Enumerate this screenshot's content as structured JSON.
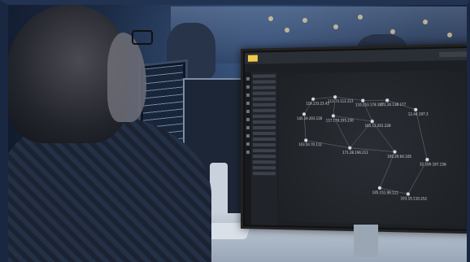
{
  "scene": {
    "description_tags": [
      "office",
      "monitors",
      "analyst"
    ]
  },
  "app": {
    "logo_label": "",
    "nav": [
      "",
      "",
      ""
    ],
    "tabs": [
      "",
      "",
      "",
      "",
      ""
    ],
    "nodes": [
      {
        "label": "119.233.23.43"
      },
      {
        "label": "113.73.112.213"
      },
      {
        "label": "110.253.178.165"
      },
      {
        "label": "172.24.138.177"
      },
      {
        "label": "145.19.203.128"
      },
      {
        "label": "117.178.195.230"
      },
      {
        "label": "165.12.201.228"
      },
      {
        "label": "12.44.197.3"
      },
      {
        "label": "103.50.70.112"
      },
      {
        "label": "171.28.190.211"
      },
      {
        "label": "100.29.64.105"
      },
      {
        "label": "32.109.167.156"
      },
      {
        "label": "105.151.99.111"
      },
      {
        "label": "103.19.110.252"
      }
    ]
  },
  "colors": {
    "accent": "#f2c94c",
    "node": "#d7dbe0",
    "edge": "#7a808a",
    "background": "#1c1f24"
  }
}
